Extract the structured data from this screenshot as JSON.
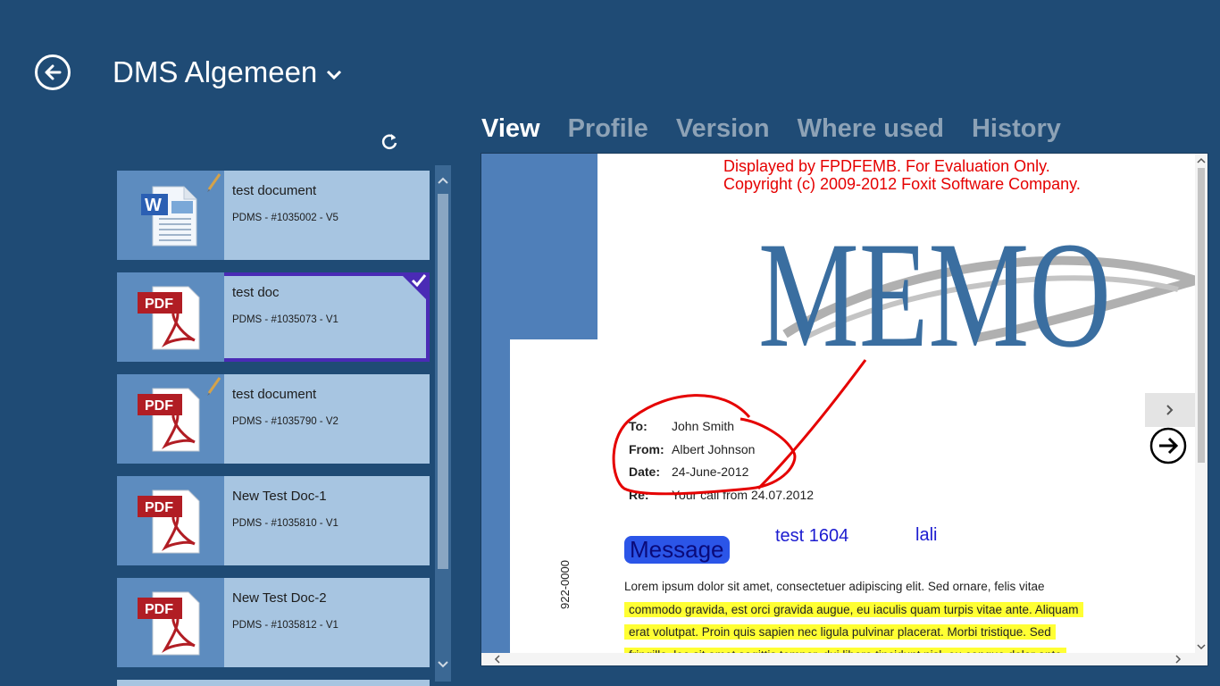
{
  "header": {
    "title": "DMS Algemeen"
  },
  "tabs": [
    {
      "label": "View",
      "active": true
    },
    {
      "label": "Profile",
      "active": false
    },
    {
      "label": "Version",
      "active": false
    },
    {
      "label": "Where used",
      "active": false
    },
    {
      "label": "History",
      "active": false
    }
  ],
  "documents": [
    {
      "name": "test document",
      "meta": "PDMS - #1035002 - V5",
      "type": "word",
      "edited": true,
      "selected": false
    },
    {
      "name": "test doc",
      "meta": "PDMS - #1035073 - V1",
      "type": "pdf",
      "edited": false,
      "selected": true
    },
    {
      "name": "test document",
      "meta": "PDMS - #1035790 - V2",
      "type": "pdf",
      "edited": true,
      "selected": false
    },
    {
      "name": "New Test Doc-1",
      "meta": "PDMS - #1035810 - V1",
      "type": "pdf",
      "edited": false,
      "selected": false
    },
    {
      "name": "New Test Doc-2",
      "meta": "PDMS - #1035812 - V1",
      "type": "pdf",
      "edited": false,
      "selected": false
    }
  ],
  "preview": {
    "eval_line1": "Displayed by FPDFEMB. For Evaluation Only.",
    "eval_line2": "Copyright (c) 2009-2012 Foxit Software Company.",
    "memo_title": "MEMO",
    "fields": [
      {
        "label": "To:",
        "value": "John Smith"
      },
      {
        "label": "From:",
        "value": "Albert Johnson"
      },
      {
        "label": "Date:",
        "value": "24-June-2012"
      },
      {
        "label": "Re:",
        "value": "Your call from 24.07.2012"
      }
    ],
    "message_label": "Message",
    "annotation_1": "test 1604",
    "annotation_2": "lali",
    "body_line1": "Lorem ipsum dolor sit amet, consectetuer adipiscing elit. Sed ornare, felis vitae",
    "body_line2": "commodo gravida, est orci gravida augue, eu iaculis quam turpis vitae ante. Aliquam",
    "body_line3": "erat volutpat. Proin quis sapien nec ligula pulvinar placerat. Morbi tristique. Sed",
    "body_line4": "fringilla, leo sit amet sagittis tempor, dui libero tincidunt nisl, eu congue dolor ante",
    "vertical_number": "922-0000"
  },
  "colors": {
    "background": "#1f4b75",
    "selection": "#4a2bb5",
    "list_item": "#a7c5e1",
    "thumb_bg": "#5d8cbf",
    "eval_red": "#e50000",
    "highlight": "#ffff33"
  },
  "icons": {
    "back": "back-arrow-icon",
    "dropdown": "chevron-down-icon",
    "refresh": "refresh-icon",
    "word": "word-document-icon",
    "pdf": "pdf-document-icon",
    "edit": "pencil-icon",
    "check": "checkmark-icon",
    "next": "arrow-right-circle-icon"
  }
}
